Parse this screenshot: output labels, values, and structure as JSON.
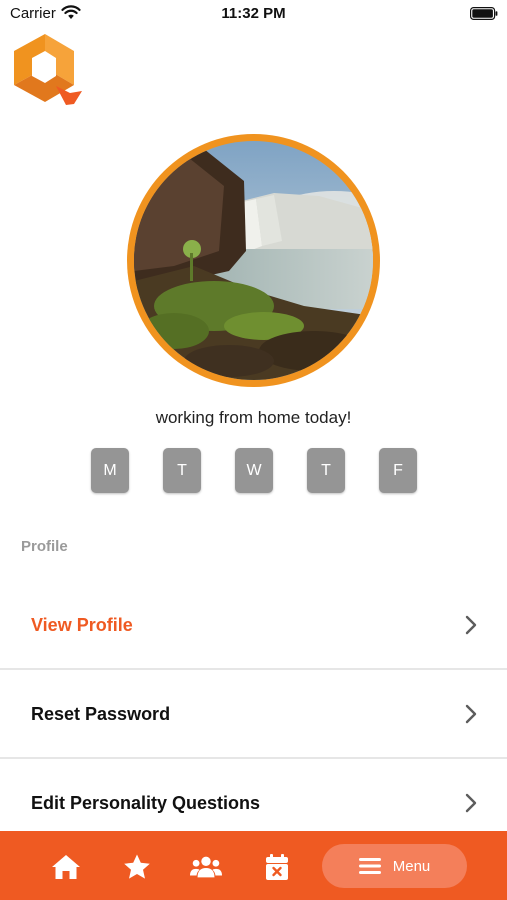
{
  "status_bar": {
    "carrier": "Carrier",
    "time": "11:32 PM"
  },
  "profile": {
    "status_message": "working from home today!"
  },
  "days": [
    "M",
    "T",
    "W",
    "T",
    "F"
  ],
  "section": {
    "label": "Profile"
  },
  "menu_items": [
    {
      "label": "View Profile"
    },
    {
      "label": "Reset Password"
    },
    {
      "label": "Edit Personality Questions"
    }
  ],
  "tab_bar": {
    "menu_label": "Menu"
  },
  "colors": {
    "accent": "#ef5a22",
    "avatar_ring": "#f0931f",
    "day_button": "#959595",
    "section_label": "#9a9a9a"
  },
  "icons": [
    "wifi-icon",
    "battery-icon",
    "app-logo",
    "chevron-right-icon",
    "home-icon",
    "star-icon",
    "people-icon",
    "calendar-x-icon",
    "hamburger-icon"
  ]
}
